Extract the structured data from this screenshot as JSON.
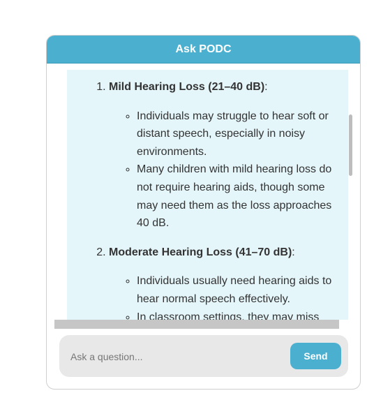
{
  "header": {
    "title": "Ask PODC"
  },
  "answer": {
    "items": [
      {
        "title": "Mild Hearing Loss (21–40 dB)",
        "suffix": ":",
        "bullets": [
          "Individuals may struggle to hear soft or distant speech, especially in noisy environments.",
          "Many children with mild hearing loss do not require hearing aids, though some may need them as the loss approaches 40 dB."
        ]
      },
      {
        "title": "Moderate Hearing Loss (41–70 dB)",
        "suffix": ":",
        "bullets": [
          "Individuals usually need hearing aids to hear normal speech effectively.",
          "In classroom settings, they may miss"
        ]
      }
    ]
  },
  "input": {
    "placeholder": "Ask a question...",
    "value": ""
  },
  "send_button": {
    "label": "Send"
  },
  "colors": {
    "accent": "#4bb0cf",
    "message_bg": "#e4f6fa",
    "input_bg": "#e8e8e8"
  }
}
